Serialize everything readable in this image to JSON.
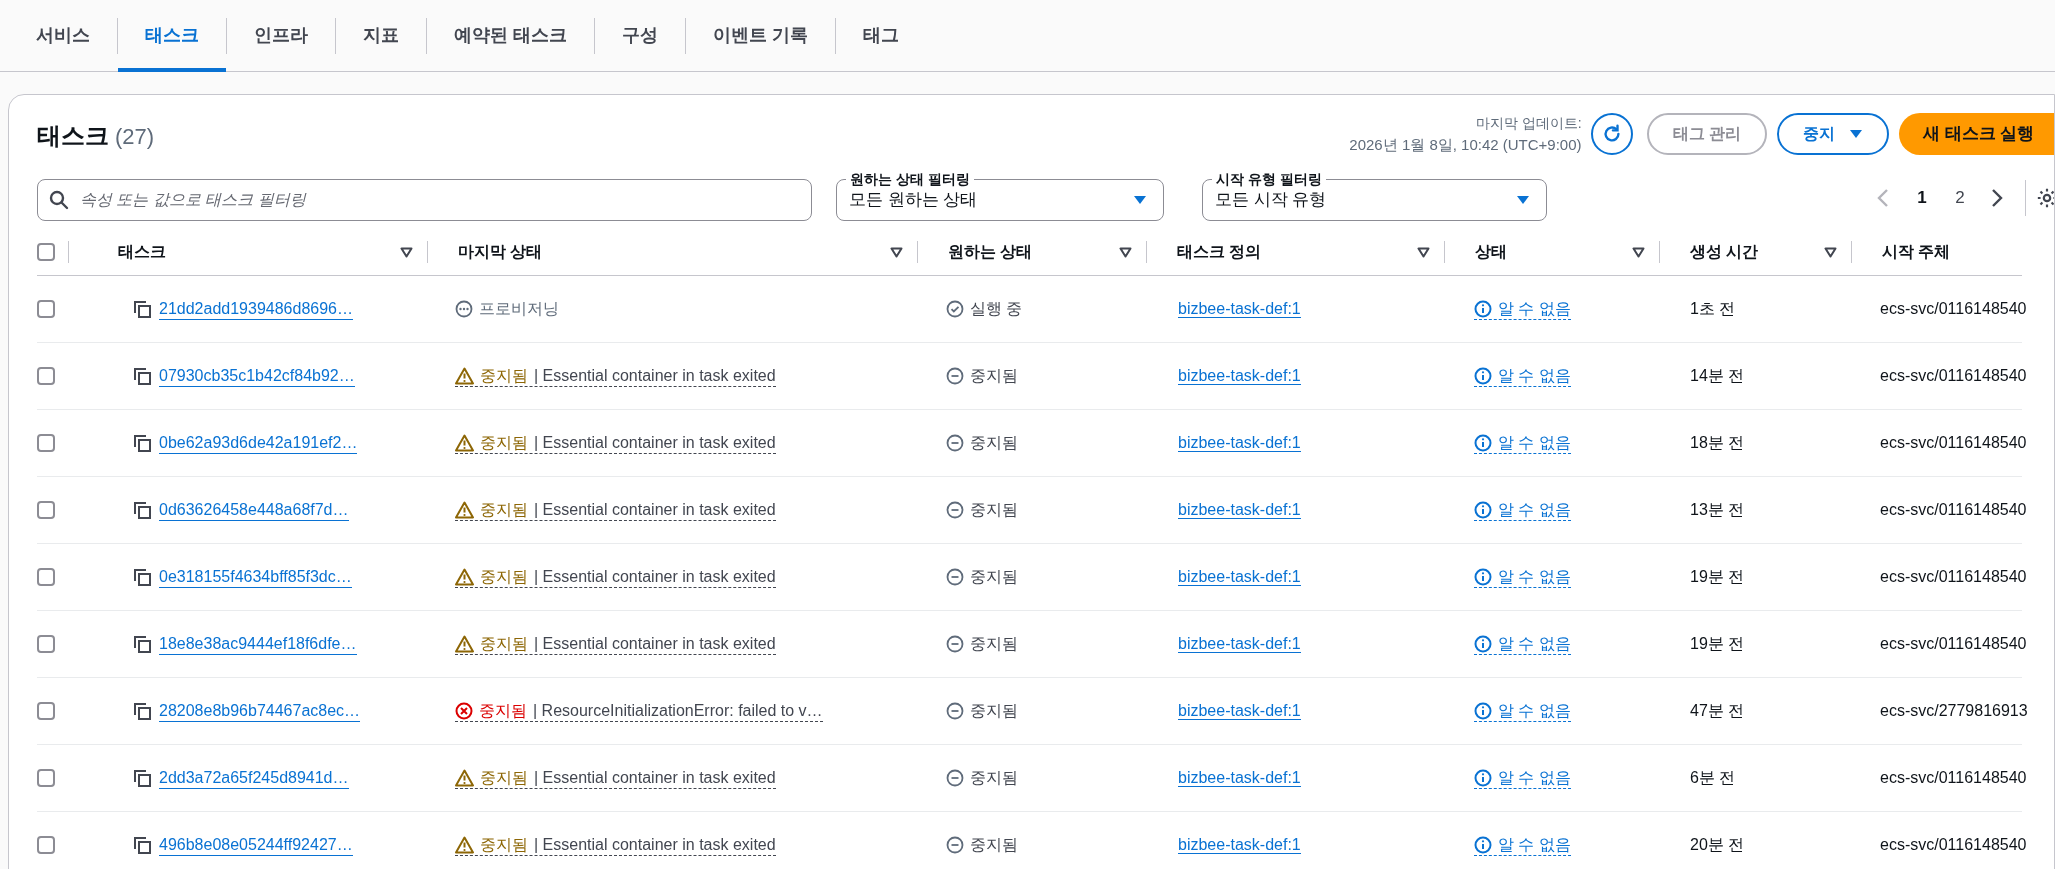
{
  "tabs": [
    {
      "label": "서비스",
      "selected": false
    },
    {
      "label": "태스크",
      "selected": true
    },
    {
      "label": "인프라",
      "selected": false
    },
    {
      "label": "지표",
      "selected": false
    },
    {
      "label": "예약된 태스크",
      "selected": false
    },
    {
      "label": "구성",
      "selected": false
    },
    {
      "label": "이벤트 기록",
      "selected": false
    },
    {
      "label": "태그",
      "selected": false
    }
  ],
  "panel": {
    "title": "태스크",
    "count": "(27)",
    "last_updated_label": "마지막 업데이트:",
    "last_updated": "2026년 1월 8일, 10:42 (UTC+9:00)",
    "buttons": [
      {
        "label": "태그 관리",
        "kind": "normal",
        "disabled": true,
        "dropdown": false
      },
      {
        "label": "중지",
        "kind": "normal",
        "disabled": false,
        "dropdown": true
      },
      {
        "label": "새 태스크 실행",
        "kind": "primary",
        "disabled": false,
        "dropdown": false
      }
    ]
  },
  "search": {
    "placeholder": "속성 또는 값으로 태스크 필터링"
  },
  "filters": [
    {
      "label": "원하는 상태 필터링",
      "value": "모든 원하는 상태"
    },
    {
      "label": "시작 유형 필터링",
      "value": "모든 시작 유형"
    }
  ],
  "pagination": {
    "previous_disabled": true,
    "next_disabled": false,
    "pages": [
      {
        "label": "1",
        "selected": true
      },
      {
        "label": "2",
        "selected": false
      }
    ]
  },
  "table": {
    "select_all_checked": false,
    "columns": [
      {
        "label": "태스크",
        "sortable": true
      },
      {
        "label": "마지막 상태",
        "sortable": true
      },
      {
        "label": "원하는 상태",
        "sortable": true
      },
      {
        "label": "태스크 정의",
        "sortable": true
      },
      {
        "label": "상태",
        "sortable": true
      },
      {
        "label": "생성 시간",
        "sortable": true
      },
      {
        "label": "시작 주체",
        "sortable": false
      }
    ],
    "rows": [
      {
        "checked": false,
        "task": "21dd2add1939486d8696…",
        "last_status": {
          "kind": "pending",
          "label": "프로비저닝"
        },
        "desired_status": {
          "kind": "running",
          "label": "실행 중"
        },
        "task_definition": "bizbee-task-def:1",
        "health": "알 수 없음",
        "created": "1초 전",
        "started_by": "ecs-svc/0116148540"
      },
      {
        "checked": false,
        "task": "07930cb35c1b42cf84b92…",
        "last_status": {
          "kind": "warning",
          "label": "중지됨",
          "reason": "| Essential container in task exited"
        },
        "desired_status": {
          "kind": "stopped",
          "label": "중지됨"
        },
        "task_definition": "bizbee-task-def:1",
        "health": "알 수 없음",
        "created": "14분 전",
        "started_by": "ecs-svc/0116148540"
      },
      {
        "checked": false,
        "task": "0be62a93d6de42a191ef2…",
        "last_status": {
          "kind": "warning",
          "label": "중지됨",
          "reason": "| Essential container in task exited"
        },
        "desired_status": {
          "kind": "stopped",
          "label": "중지됨"
        },
        "task_definition": "bizbee-task-def:1",
        "health": "알 수 없음",
        "created": "18분 전",
        "started_by": "ecs-svc/0116148540"
      },
      {
        "checked": false,
        "task": "0d63626458e448a68f7d…",
        "last_status": {
          "kind": "warning",
          "label": "중지됨",
          "reason": "| Essential container in task exited"
        },
        "desired_status": {
          "kind": "stopped",
          "label": "중지됨"
        },
        "task_definition": "bizbee-task-def:1",
        "health": "알 수 없음",
        "created": "13분 전",
        "started_by": "ecs-svc/0116148540"
      },
      {
        "checked": false,
        "task": "0e318155f4634bff85f3dc…",
        "last_status": {
          "kind": "warning",
          "label": "중지됨",
          "reason": "| Essential container in task exited"
        },
        "desired_status": {
          "kind": "stopped",
          "label": "중지됨"
        },
        "task_definition": "bizbee-task-def:1",
        "health": "알 수 없음",
        "created": "19분 전",
        "started_by": "ecs-svc/0116148540"
      },
      {
        "checked": false,
        "task": "18e8e38ac9444ef18f6dfe…",
        "last_status": {
          "kind": "warning",
          "label": "중지됨",
          "reason": "| Essential container in task exited"
        },
        "desired_status": {
          "kind": "stopped",
          "label": "중지됨"
        },
        "task_definition": "bizbee-task-def:1",
        "health": "알 수 없음",
        "created": "19분 전",
        "started_by": "ecs-svc/0116148540"
      },
      {
        "checked": false,
        "task": "28208e8b96b74467ac8ec…",
        "last_status": {
          "kind": "error",
          "label": "중지됨",
          "reason": "| ResourceInitializationError: failed to v…"
        },
        "desired_status": {
          "kind": "stopped",
          "label": "중지됨"
        },
        "task_definition": "bizbee-task-def:1",
        "health": "알 수 없음",
        "created": "47분 전",
        "started_by": "ecs-svc/2779816913"
      },
      {
        "checked": false,
        "task": "2dd3a72a65f245d8941d…",
        "last_status": {
          "kind": "warning",
          "label": "중지됨",
          "reason": "| Essential container in task exited"
        },
        "desired_status": {
          "kind": "stopped",
          "label": "중지됨"
        },
        "task_definition": "bizbee-task-def:1",
        "health": "알 수 없음",
        "created": "6분 전",
        "started_by": "ecs-svc/0116148540"
      },
      {
        "checked": false,
        "task": "496b8e08e05244ff92427…",
        "last_status": {
          "kind": "warning",
          "label": "중지됨",
          "reason": "| Essential container in task exited"
        },
        "desired_status": {
          "kind": "stopped",
          "label": "중지됨"
        },
        "task_definition": "bizbee-task-def:1",
        "health": "알 수 없음",
        "created": "20분 전",
        "started_by": "ecs-svc/0116148540"
      }
    ]
  }
}
